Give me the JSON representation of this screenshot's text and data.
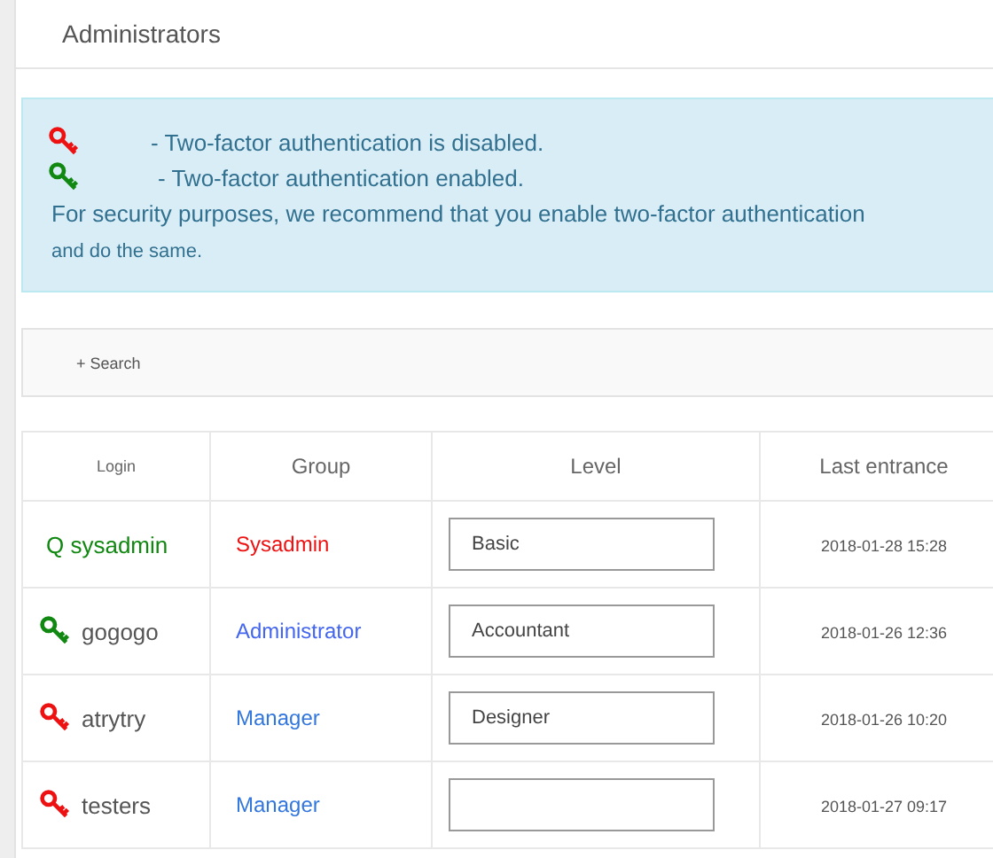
{
  "page_title": "Administrators",
  "notice": {
    "lines": [
      {
        "kind": "key",
        "two_factor": false,
        "text": "- Two-factor authentication is disabled."
      },
      {
        "kind": "key",
        "two_factor": true,
        "text": "- Two-factor authentication enabled."
      },
      {
        "kind": "text",
        "text": "For security purposes, we recommend that you enable two-factor authentication"
      },
      {
        "kind": "small",
        "text": "and do the same."
      }
    ]
  },
  "search": {
    "label": "+ Search"
  },
  "table": {
    "columns": [
      "Login",
      "Group",
      "Level",
      "Last entrance"
    ],
    "rows": [
      {
        "login": {
          "kind": "plain",
          "text": "Q sysadmin"
        },
        "group": {
          "text": "Sysadmin",
          "color": "#ee1111"
        },
        "level": "Basic",
        "last": "2018-01-28 15:28"
      },
      {
        "login": {
          "kind": "key",
          "two_factor": true,
          "text": "gogogo"
        },
        "group": {
          "text": "Administrator",
          "color": "#4466ee"
        },
        "level": "Accountant",
        "last": "2018-01-26 12:36"
      },
      {
        "login": {
          "kind": "key",
          "two_factor": false,
          "text": "atrytry"
        },
        "group": {
          "text": "Manager",
          "color": "#3377dd"
        },
        "level": "Designer",
        "last": "2018-01-26 10:20"
      },
      {
        "login": {
          "kind": "key",
          "two_factor": false,
          "text": "testers"
        },
        "group": {
          "text": "Manager",
          "color": "#3377dd"
        },
        "last": "2018-01-27 09:17"
      }
    ]
  }
}
